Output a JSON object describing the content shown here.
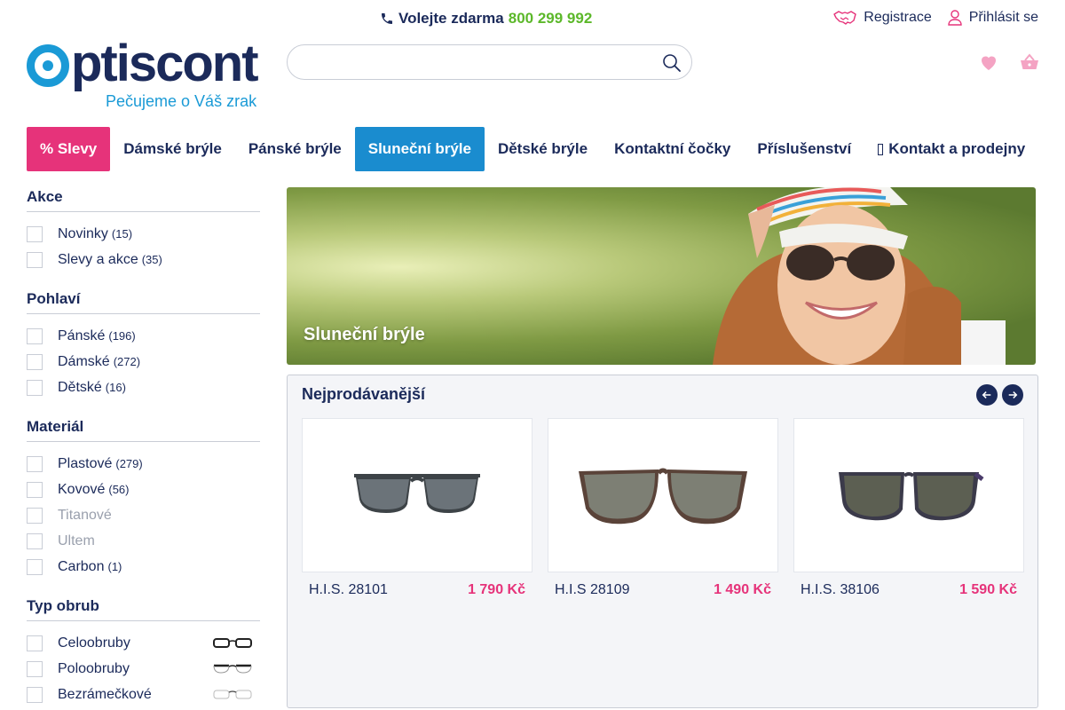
{
  "topbar": {
    "hotline_label": "Volejte zdarma",
    "hotline_number": "800 299 992",
    "register_label": "Registrace",
    "login_label": "Přihlásit se"
  },
  "logo": {
    "wordmark": "ptiscont",
    "tagline": "Pečujeme o Váš zrak"
  },
  "search": {
    "value": "",
    "placeholder": ""
  },
  "nav": {
    "items": [
      {
        "label": "% Slevy"
      },
      {
        "label": "Dámské brýle"
      },
      {
        "label": "Pánské brýle"
      },
      {
        "label": "Sluneční brýle"
      },
      {
        "label": "Dětské brýle"
      },
      {
        "label": "Kontaktní čočky"
      },
      {
        "label": "Příslušenství"
      },
      {
        "label": "Kontakt a prodejny"
      }
    ],
    "active": "Sluneční brýle"
  },
  "filters": {
    "akce": {
      "title": "Akce",
      "items": [
        {
          "label": "Novinky",
          "count": "(15)"
        },
        {
          "label": "Slevy a akce",
          "count": "(35)"
        }
      ]
    },
    "pohlavi": {
      "title": "Pohlaví",
      "items": [
        {
          "label": "Pánské",
          "count": "(196)"
        },
        {
          "label": "Dámské",
          "count": "(272)"
        },
        {
          "label": "Dětské",
          "count": "(16)"
        }
      ]
    },
    "material": {
      "title": "Materiál",
      "items": [
        {
          "label": "Plastové",
          "count": "(279)"
        },
        {
          "label": "Kovové",
          "count": "(56)"
        },
        {
          "label": "Titanové",
          "count": ""
        },
        {
          "label": "Ultem",
          "count": ""
        },
        {
          "label": "Carbon",
          "count": "(1)"
        }
      ]
    },
    "typ": {
      "title": "Typ obrub",
      "items": [
        {
          "label": "Celoobruby"
        },
        {
          "label": "Poloobruby"
        },
        {
          "label": "Bezrámečkové"
        }
      ]
    }
  },
  "banner": {
    "label": "Sluneční brýle"
  },
  "bestsellers": {
    "title": "Nejprodávanější",
    "products": [
      {
        "name": "H.I.S. 28101",
        "price": "1 790 Kč"
      },
      {
        "name": "H.I.S 28109",
        "price": "1 490 Kč"
      },
      {
        "name": "H.I.S. 38106",
        "price": "1 590 Kč"
      }
    ]
  },
  "colors": {
    "navy": "#1b2a5a",
    "brand_blue": "#1a9ad6",
    "sale_pink": "#e6337a",
    "active_blue": "#1a8ccf",
    "phone_green": "#5cb82a"
  }
}
